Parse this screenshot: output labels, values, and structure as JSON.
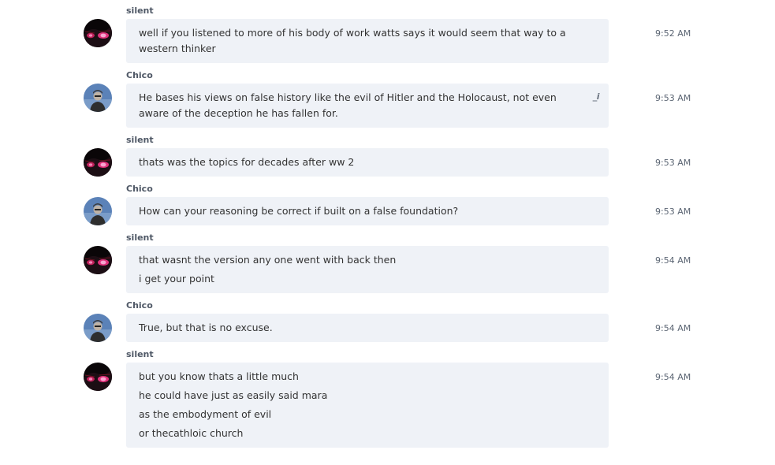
{
  "messages": [
    {
      "sender": "silent",
      "avatar": "silent-avatar-icon",
      "time": "9:52 AM",
      "lines": [
        "well if you listened to more of his body of work  watts says it would seem that way to a western thinker"
      ]
    },
    {
      "sender": "Chico",
      "avatar": "chico-avatar-icon",
      "time": "9:53 AM",
      "lines": [
        "He bases his views on false history like the evil of Hitler and the Holocaust, not even aware of the deception he has fallen for."
      ],
      "action_icon": "edit-italic-icon",
      "action_text": "_i"
    },
    {
      "sender": "silent",
      "avatar": "silent-avatar-icon",
      "time": "9:53 AM",
      "lines": [
        "thats was  the topics for decades  after ww 2"
      ]
    },
    {
      "sender": "Chico",
      "avatar": "chico-avatar-icon",
      "time": "9:53 AM",
      "lines": [
        "How can your reasoning be correct if built on a false foundation?"
      ]
    },
    {
      "sender": "silent",
      "avatar": "silent-avatar-icon",
      "time": "9:54 AM",
      "lines": [
        "that wasnt the version any one went with back then",
        "i get your point"
      ]
    },
    {
      "sender": "Chico",
      "avatar": "chico-avatar-icon",
      "time": "9:54 AM",
      "lines": [
        "True, but that is no excuse."
      ]
    },
    {
      "sender": "silent",
      "avatar": "silent-avatar-icon",
      "time": "9:54 AM",
      "lines": [
        "but you know thats  a little much",
        "he could have just as easily said mara",
        "as the embodyment of evil",
        "or thecathloic church"
      ]
    }
  ]
}
